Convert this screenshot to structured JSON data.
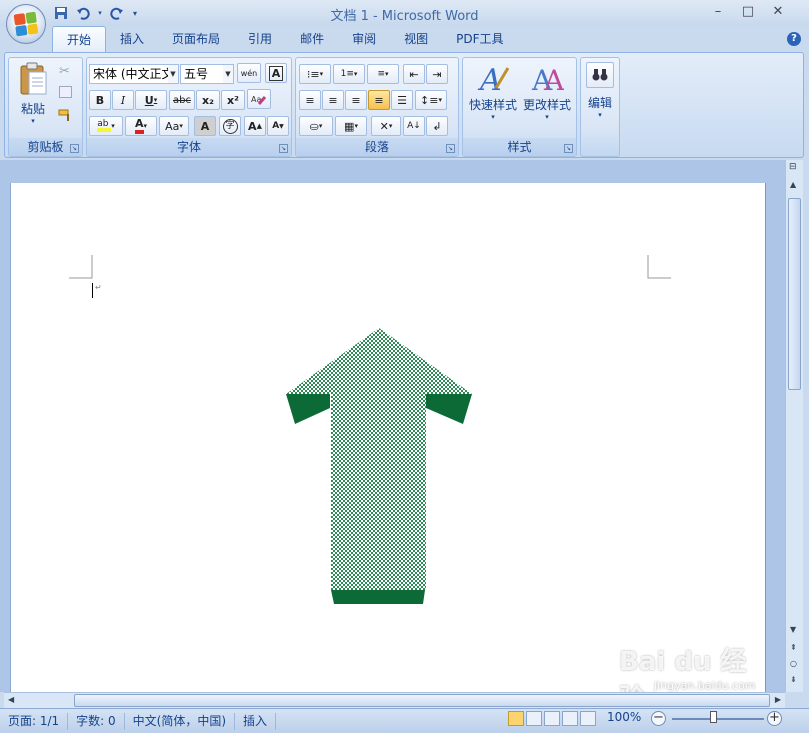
{
  "window": {
    "title": "文档 1 - Microsoft Word",
    "minimize": "–",
    "maximize": "□",
    "close": "✕"
  },
  "qat": {
    "save_icon": "save-icon",
    "undo_icon": "undo-icon",
    "redo_icon": "redo-icon",
    "customize_icon": "dropdown-icon"
  },
  "tabs": [
    {
      "label": "开始",
      "active": true
    },
    {
      "label": "插入"
    },
    {
      "label": "页面布局"
    },
    {
      "label": "引用"
    },
    {
      "label": "邮件"
    },
    {
      "label": "审阅"
    },
    {
      "label": "视图"
    },
    {
      "label": "PDF工具"
    }
  ],
  "help": "?",
  "ribbon": {
    "clipboard": {
      "label": "剪贴板",
      "paste": "粘贴"
    },
    "font": {
      "label": "字体",
      "font_name": "宋体 (中文正文",
      "font_size": "五号",
      "bold": "B",
      "italic": "I",
      "underline": "U",
      "strike": "abc",
      "subscript": "x₂",
      "superscript": "x²",
      "grow": "A",
      "shrink": "A",
      "change_case": "Aa",
      "char_shading": "A",
      "enclose": "字",
      "phonetic": "wén",
      "char_border": "A"
    },
    "paragraph": {
      "label": "段落"
    },
    "styles": {
      "label": "样式",
      "quick_styles": "快速样式",
      "change_styles": "更改样式"
    },
    "editing": {
      "label": "编辑"
    }
  },
  "colors": {
    "arrow_fill": "#2e8b57",
    "arrow_dark": "#0b6a35",
    "highlight_yellow": "#f5f53a",
    "font_red": "#e02020"
  },
  "status": {
    "page": "页面: 1/1",
    "words": "字数: 0",
    "language": "中文(简体，中国)",
    "mode": "插入",
    "zoom": "100%"
  },
  "watermark": {
    "brand": "Bai du 经验",
    "url": "jingyan.baidu.com"
  }
}
